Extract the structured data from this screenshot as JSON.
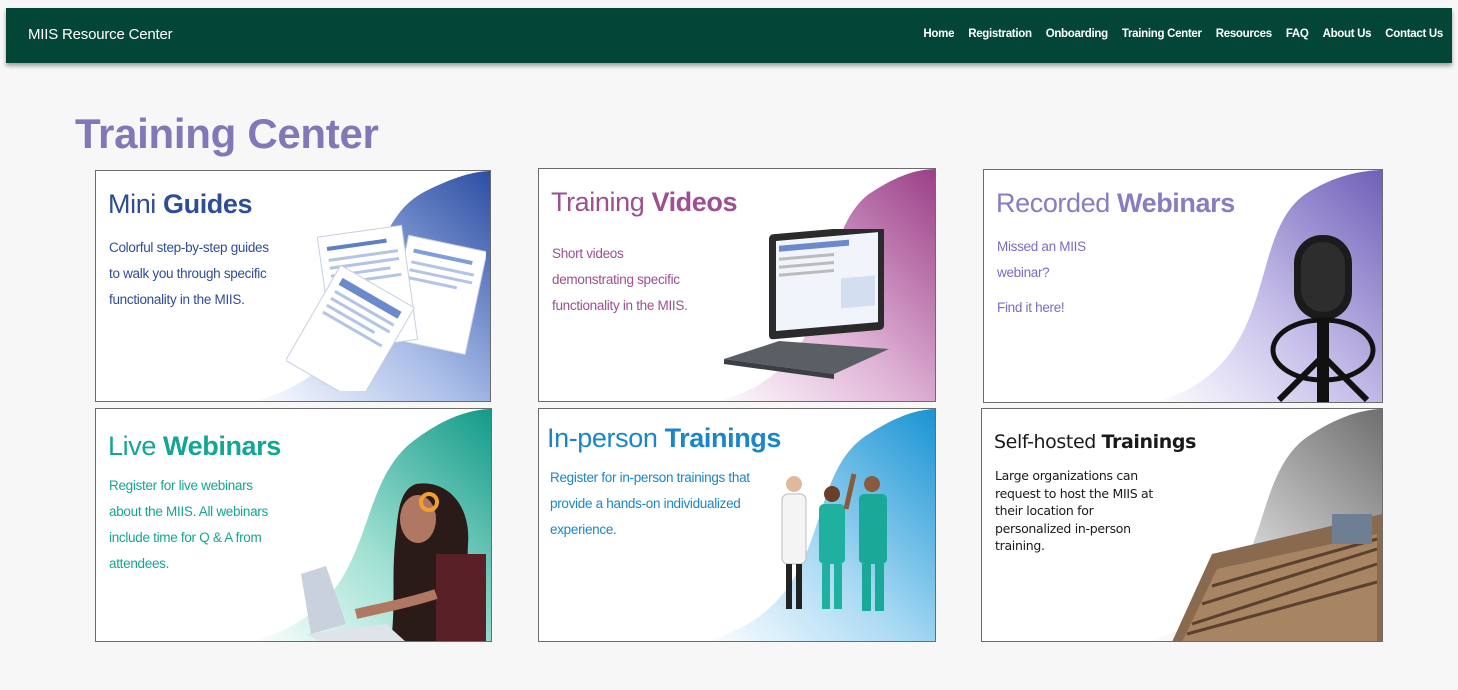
{
  "header": {
    "brand": "MIIS Resource Center",
    "nav": [
      {
        "label": "Home"
      },
      {
        "label": "Registration"
      },
      {
        "label": "Onboarding"
      },
      {
        "label": "Training Center"
      },
      {
        "label": "Resources"
      },
      {
        "label": "FAQ"
      },
      {
        "label": "About Us"
      },
      {
        "label": "Contact Us"
      }
    ]
  },
  "main": {
    "title": "Training Center",
    "cards": [
      {
        "title_a": "Mini ",
        "title_b": "Guides",
        "desc": "Colorful step-by-step guides to walk you through specific functionality in the MIIS.",
        "color": "#2e4d96",
        "accent": "#3a5eb0"
      },
      {
        "title_a": "Training ",
        "title_b": "Videos",
        "desc": "Short videos demonstrating specific functionality in the MIIS.",
        "color": "#9d4f8f",
        "accent": "#a24b90"
      },
      {
        "title_a": "Recorded ",
        "title_b": "Webinars",
        "desc": "Missed an MIIS webinar?",
        "desc2": "Find it here!",
        "color": "#8a7cc2",
        "accent": "#7b6cc0"
      },
      {
        "title_a": "Live ",
        "title_b": "Webinars",
        "desc": "Register for live webinars about the MIIS. All webinars include time for Q & A from attendees.",
        "color": "#14a594",
        "accent": "#1aa592"
      },
      {
        "title_a": "In-person ",
        "title_b": "Trainings",
        "desc": "Register for in-person trainings that provide a hands-on individualized experience.",
        "color": "#1a86c8",
        "accent": "#1e9bd8"
      },
      {
        "title_a": "Self-hosted ",
        "title_b": "Trainings",
        "desc": "Large organizations can request to host the MIIS at their location for personalized in-person training.",
        "color": "#1a1a1a",
        "accent": "#7a7a7a"
      }
    ]
  }
}
